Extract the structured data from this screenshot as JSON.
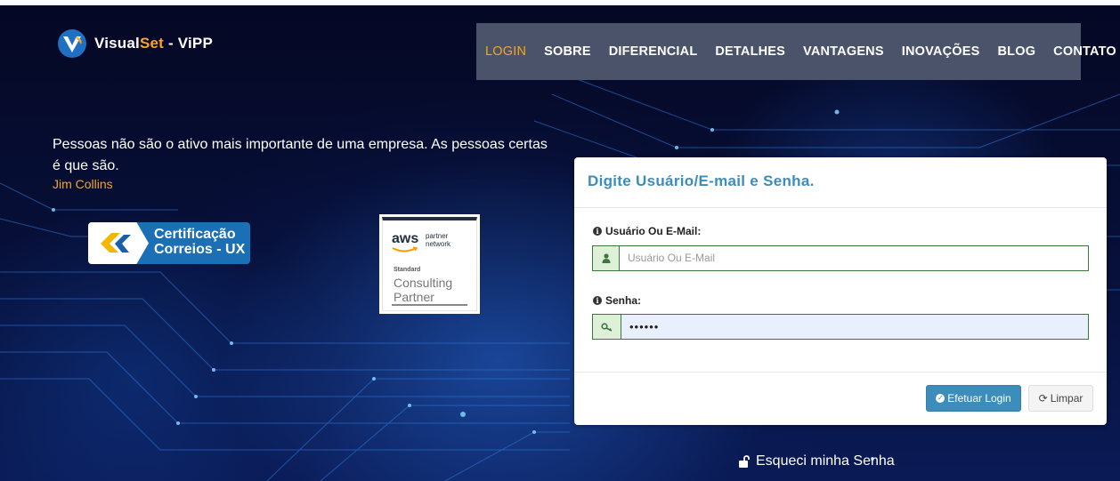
{
  "brand": {
    "part1": "Visual",
    "part2": "Set",
    "part3": " - ViPP"
  },
  "nav": [
    {
      "label": "LOGIN",
      "active": true
    },
    {
      "label": "SOBRE"
    },
    {
      "label": "DIFERENCIAL"
    },
    {
      "label": "DETALHES"
    },
    {
      "label": "VANTAGENS"
    },
    {
      "label": "INOVAÇÕES"
    },
    {
      "label": "BLOG"
    },
    {
      "label": "CONTATO"
    }
  ],
  "quote": {
    "text": "Pessoas não são o ativo mais importante de uma empresa. As pessoas certas é que são.",
    "author": "Jim Collins"
  },
  "badges": {
    "correios_line1": "Certificação",
    "correios_line2": "Correios - UX",
    "aws_logo": "aws",
    "aws_partner_line1": "partner",
    "aws_partner_line2": "network",
    "aws_tier": "Standard",
    "aws_type_line1": "Consulting",
    "aws_type_line2": "Partner"
  },
  "login_panel": {
    "title": "Digite Usuário/E-mail e Senha.",
    "user_label": "Usuário Ou E-Mail:",
    "user_placeholder": "Usuário Ou E-Mail",
    "password_label": "Senha:",
    "password_value": "••••••",
    "login_button": "Efetuar Login",
    "clear_button": "Limpar"
  },
  "forgot_password": "Esqueci minha Senha",
  "colors": {
    "accent": "#f5a623",
    "primary": "#3c8dbc",
    "nav_bg": "#4a5369",
    "success": "#3c763d"
  }
}
